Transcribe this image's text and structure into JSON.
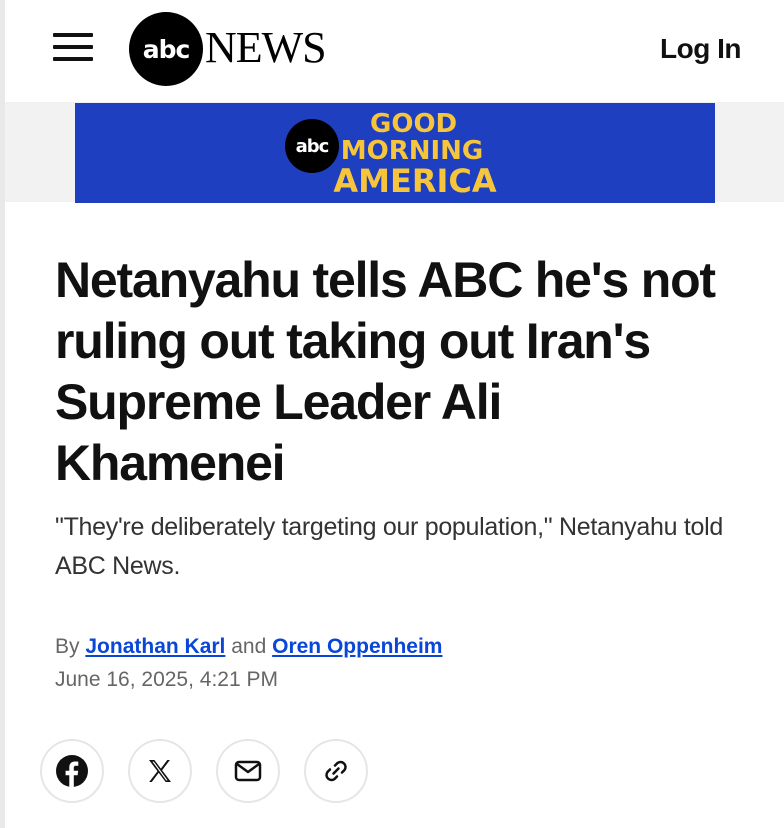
{
  "header": {
    "menu_label": "",
    "logo": {
      "badge": "abc",
      "wordmark": "NEWS"
    },
    "login_label": "Log In"
  },
  "banner": {
    "badge": "abc",
    "line1": "GOOD",
    "line2": "MORNING",
    "line3": "AMERICA",
    "bg_color": "#1e3fbf",
    "text_color": "#f6c53c"
  },
  "article": {
    "headline": "Netanyahu tells ABC he's not ruling out taking out Iran's Supreme Leader Ali Khamenei",
    "subhead": "\"They're deliberately targeting our population,\" Netanyahu told ABC News.",
    "byline": {
      "prefix": "By",
      "author1": "Jonathan Karl",
      "conjunction": "and",
      "author2": "Oren Oppenheim"
    },
    "date": "June 16, 2025, 4:21 PM"
  },
  "share": {
    "icons": [
      "facebook-icon",
      "x-icon",
      "email-icon",
      "link-icon"
    ]
  },
  "colors": {
    "link": "#0a47d6",
    "text": "#111111",
    "muted": "#666666"
  }
}
